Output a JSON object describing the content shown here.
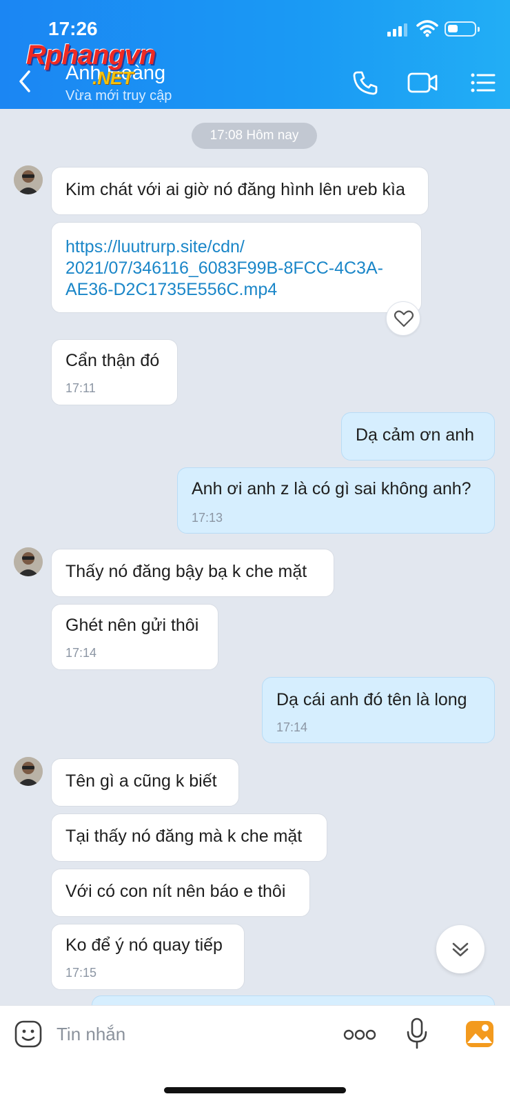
{
  "status_bar": {
    "time": "17:26"
  },
  "header": {
    "contact_name": "Anh Hoàng",
    "contact_status": "Vừa mới truy cập",
    "watermark_main": "Rphangvn",
    "watermark_sub": ".NET"
  },
  "date_separator": "17:08 Hôm nay",
  "messages": [
    {
      "dir": "in",
      "text": "Kim chát với ai giờ nó đăng hình lên ưeb kìa"
    },
    {
      "dir": "in",
      "link": "https://luutrurp.site/cdn/2021/07/346116_6083F99B-8FCC-4C3A-AE36-D2C1735E556C.mp4",
      "link_lines": [
        "https://luutrurp.site/cdn/",
        "2021/07/346116_6083F99B-8FCC-4C3A-",
        "AE36-D2C1735E556C.mp4"
      ]
    },
    {
      "dir": "in",
      "text": "Cẩn thận đó",
      "time": "17:11"
    },
    {
      "dir": "out",
      "text": "Dạ cảm ơn anh"
    },
    {
      "dir": "out",
      "text": "Anh ơi anh z là có gì sai không anh?",
      "time": "17:13"
    },
    {
      "dir": "in",
      "text": "Thấy nó đăng bậy bạ k che mặt"
    },
    {
      "dir": "in",
      "text": "Ghét nên gửi thôi",
      "time": "17:14"
    },
    {
      "dir": "out",
      "text": "Dạ cái anh đó tên là long",
      "time": "17:14"
    },
    {
      "dir": "in",
      "text": "Tên gì a cũng k biết"
    },
    {
      "dir": "in",
      "text": "Tại thấy nó đăng mà k che mặt"
    },
    {
      "dir": "in",
      "text": "Với có con nít nên báo e thôi"
    },
    {
      "dir": "in",
      "text": "Ko để ý nó quay tiếp",
      "time": "17:15"
    }
  ],
  "input_bar": {
    "placeholder": "Tin nhắn",
    "more_label": "ooo"
  },
  "colors": {
    "header_blue": "#1b86f3",
    "incoming_bubble": "#ffffff",
    "outgoing_bubble": "#d6eefe",
    "link": "#1a86c8",
    "image_button": "#f39a1e"
  },
  "icons": [
    "back-arrow-icon",
    "phone-icon",
    "video-call-icon",
    "menu-list-icon",
    "heart-icon",
    "double-chevron-down-icon",
    "sticker-icon",
    "microphone-icon",
    "image-icon"
  ]
}
